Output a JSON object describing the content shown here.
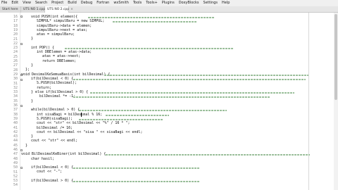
{
  "menu": [
    "File",
    "Edit",
    "View",
    "Search",
    "Project",
    "Build",
    "Debug",
    "Fortran",
    "wxSmith",
    "Tools",
    "Tools+",
    "Plugins",
    "DoxyBlocks",
    "Settings",
    "Help"
  ],
  "tabs": [
    {
      "label": "Start here",
      "active": false
    },
    {
      "label": "UTS NO 1.cpp",
      "active": false
    },
    {
      "label": "UTS NO 2.cpp",
      "active": true
    }
  ],
  "line_numbers": [
    "16",
    "17",
    "18",
    "19",
    "20",
    "21",
    "22",
    "23",
    "24",
    "25",
    "26",
    "27",
    "28",
    "29",
    "30",
    "31",
    "32",
    "33",
    "34",
    "35",
    "36",
    "37",
    "38",
    "39",
    "40",
    "41",
    "42",
    "43",
    "44",
    "45",
    "46",
    "47",
    "48",
    "49",
    "50",
    "51",
    "52",
    "53",
    "54"
  ],
  "code": {
    "l16": "void PUSH(int elemen){",
    "l17": "SIMPUL* simpulBaru = new SIMPUL;",
    "l18": "simpulBaru->data = elemen;",
    "l19": "simpulBaru->next = atas;",
    "l20": "atas = simpulBaru;",
    "l21": "}",
    "l23": "int POP() {",
    "l24": "int DBElemen = atas->data;",
    "l25": "atas = atas->next;",
    "l26": "return DBElemen;",
    "l27": "}",
    "l28": "};",
    "l30": "void DesimalKeSemuaBasis(int bilDesimal) {",
    "l31": "if(bilDesimal < 0) {",
    "l32": "S.PUSH(bilDesimal);",
    "l33": "return;",
    "l34": "} else if(bilDesimal > 0) {",
    "l35": "bilDesimal *= -1;",
    "l36": "}",
    "l38": "while(bilDesimal > 0) {",
    "l39": "int sisaBagi = bilDesimal % 16;",
    "l40": "S.PUSH(sisaBagi);",
    "l41": "cout << \"str\" << bilDesimal << \"%\" / 16 * \";",
    "l42": "bilDesimal /= 16;",
    "l43": "cout << bilDesimal << \"sisa \" << sisaBagi << endl;",
    "l44": "}",
    "l45": "cout << \"str\" << endl;",
    "l46": "}",
    "l48": "void BilDesimalKeBiner(int bilDesimal) {",
    "l49": "char hasil;",
    "l51": "if(bilDesimal < 0) {",
    "l52": "cout << \"-\";",
    "l54": "if(bilDesimal > 0) {"
  }
}
